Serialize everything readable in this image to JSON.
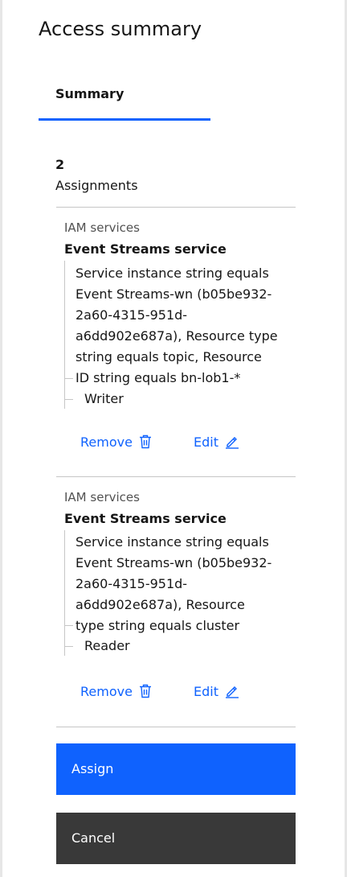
{
  "panel": {
    "title": "Access summary"
  },
  "tabs": [
    {
      "label": "Summary",
      "selected": true
    }
  ],
  "summary": {
    "count": "2",
    "count_label": "Assignments"
  },
  "assignments": [
    {
      "category": "IAM services",
      "service": "Event Streams service",
      "condition": "Service instance string equals\nEvent Streams-wn (b05be932-\n2a60-4315-951d-\na6dd902e687a), Resource type\nstring equals topic, Resource\nID string equals bn-lob1-*",
      "role": "Writer",
      "remove_label": "Remove",
      "edit_label": "Edit"
    },
    {
      "category": "IAM services",
      "service": "Event Streams service",
      "condition": "Service instance string equals\nEvent Streams-wn (b05be932-\n2a60-4315-951d-\na6dd902e687a), Resource\ntype string equals cluster",
      "role": "Reader",
      "remove_label": "Remove",
      "edit_label": "Edit"
    }
  ],
  "buttons": {
    "assign_label": "Assign",
    "cancel_label": "Cancel"
  },
  "colors": {
    "accent": "#0f62fe",
    "secondary_button": "#393939",
    "divider": "#c6c6c6"
  },
  "icons": {
    "remove": "trash-icon",
    "edit": "pencil-icon"
  }
}
